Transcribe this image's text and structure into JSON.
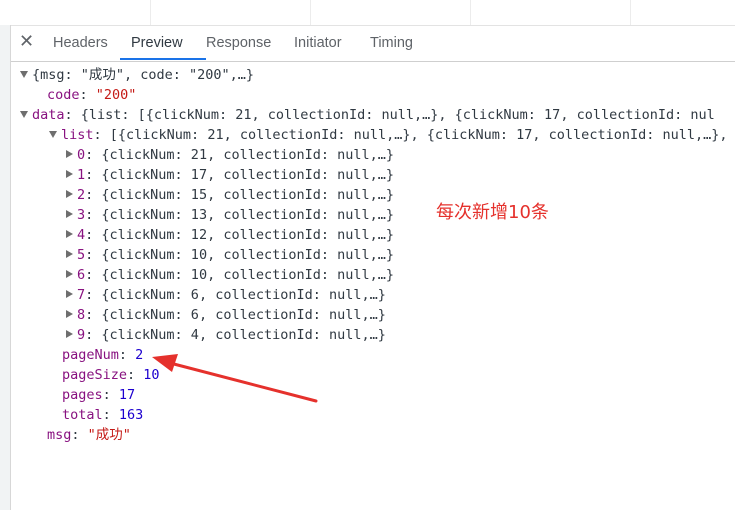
{
  "tabs": {
    "close_icon": "✕",
    "items": [
      "Headers",
      "Preview",
      "Response",
      "Initiator",
      "Timing"
    ],
    "active": "Preview"
  },
  "preview": {
    "root_summary": "{msg: \"成功\", code: \"200\",…}",
    "code_key": "code",
    "code_value": "\"200\"",
    "data_key": "data",
    "data_summary": "{list: [{clickNum: 21, collectionId: null,…}, {clickNum: 17, collectionId: nul",
    "list_key": "list",
    "list_summary": "[{clickNum: 21, collectionId: null,…}, {clickNum: 17, collectionId: null,…},",
    "items": [
      {
        "index": "0",
        "summary": "{clickNum: 21, collectionId: null,…}"
      },
      {
        "index": "1",
        "summary": "{clickNum: 17, collectionId: null,…}"
      },
      {
        "index": "2",
        "summary": "{clickNum: 15, collectionId: null,…}"
      },
      {
        "index": "3",
        "summary": "{clickNum: 13, collectionId: null,…}"
      },
      {
        "index": "4",
        "summary": "{clickNum: 12, collectionId: null,…}"
      },
      {
        "index": "5",
        "summary": "{clickNum: 10, collectionId: null,…}"
      },
      {
        "index": "6",
        "summary": "{clickNum: 10, collectionId: null,…}"
      },
      {
        "index": "7",
        "summary": "{clickNum: 6, collectionId: null,…}"
      },
      {
        "index": "8",
        "summary": "{clickNum: 6, collectionId: null,…}"
      },
      {
        "index": "9",
        "summary": "{clickNum: 4, collectionId: null,…}"
      }
    ],
    "pageNum_key": "pageNum",
    "pageNum_value": "2",
    "pageSize_key": "pageSize",
    "pageSize_value": "10",
    "pages_key": "pages",
    "pages_value": "17",
    "total_key": "total",
    "total_value": "163",
    "msg_key": "msg",
    "msg_value": "\"成功\""
  },
  "annotation": {
    "text": "每次新增10条",
    "color": "#e5312c"
  }
}
